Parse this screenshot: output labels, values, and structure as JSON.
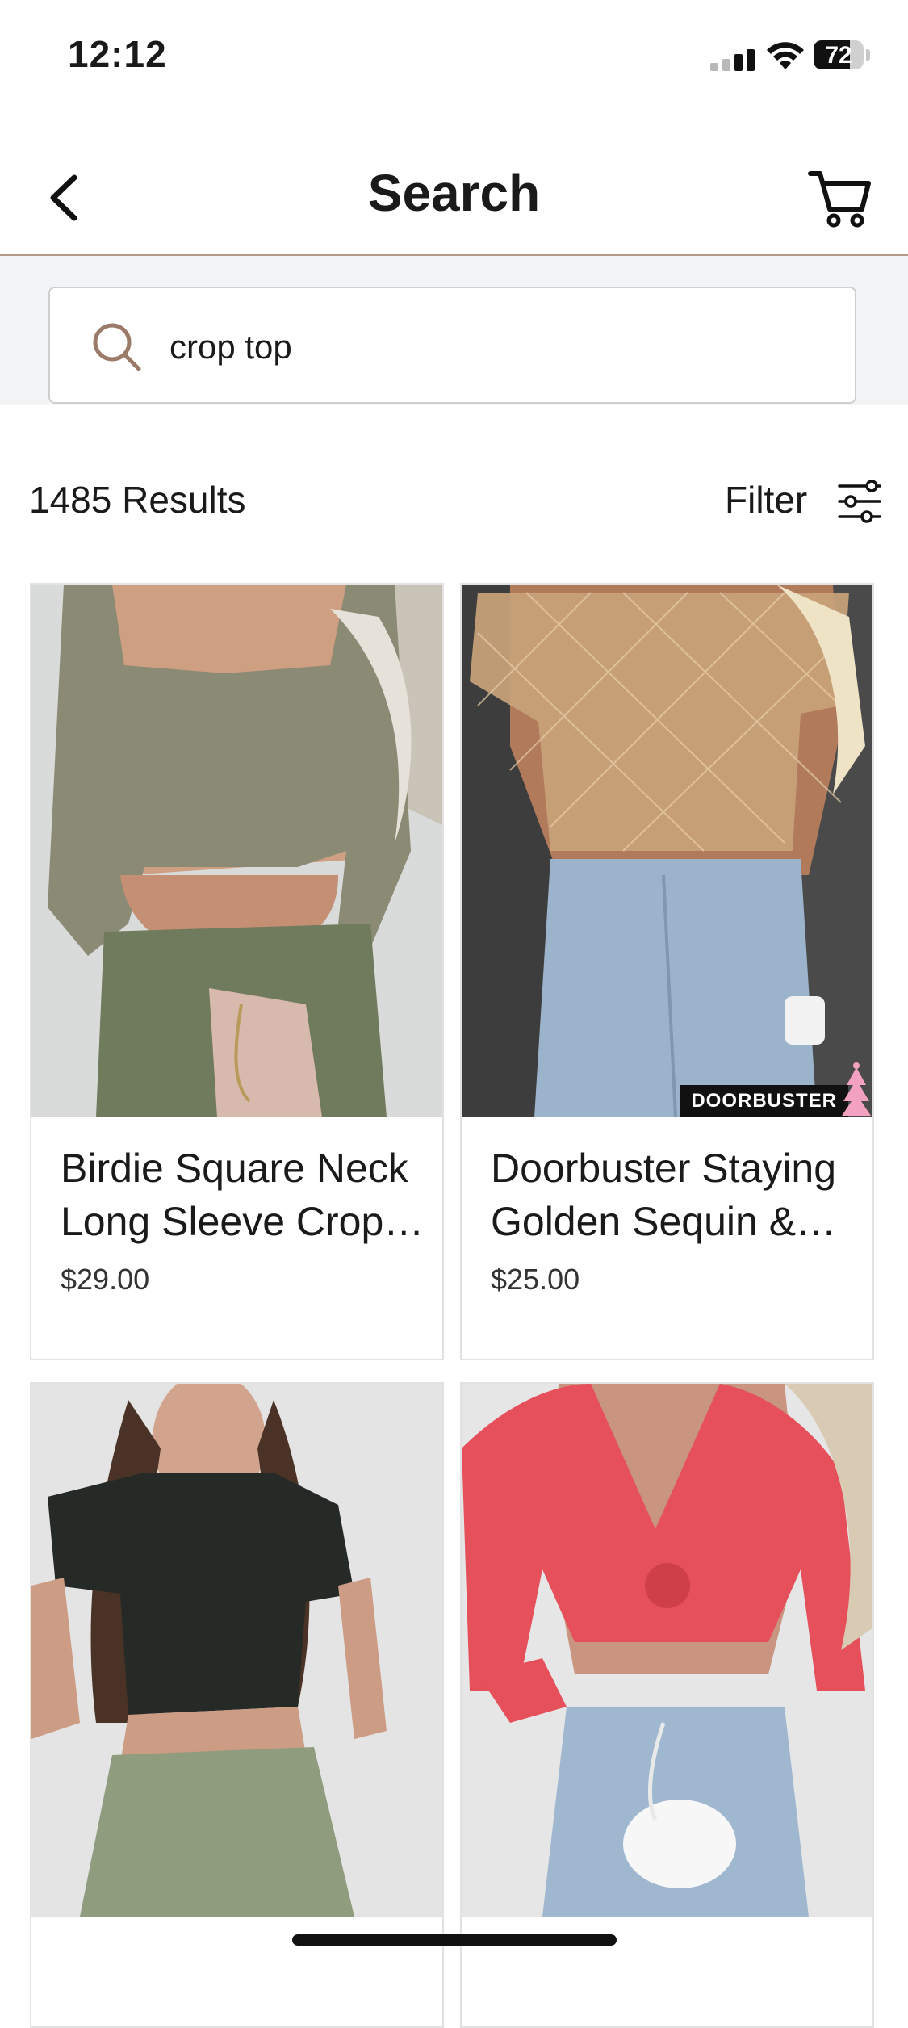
{
  "status_bar": {
    "time": "12:12",
    "battery_level": "72",
    "battery_fraction": 0.72
  },
  "header": {
    "title": "Search"
  },
  "search": {
    "value": "crop top",
    "placeholder": "Search"
  },
  "results": {
    "count_label": "1485 Results",
    "filter_label": "Filter"
  },
  "products": [
    {
      "name": "Birdie Square Neck Long Sleeve Crop…",
      "price": "$29.00",
      "badge": ""
    },
    {
      "name": "Doorbuster Staying Golden Sequin &…",
      "price": "$25.00",
      "badge": "DOORBUSTER"
    },
    {
      "name": "",
      "price": "",
      "badge": ""
    },
    {
      "name": "",
      "price": "",
      "badge": ""
    }
  ],
  "colors": {
    "accent": "#9a7b69",
    "rule": "#b59a8a",
    "search_bg": "#f3f4f6"
  }
}
